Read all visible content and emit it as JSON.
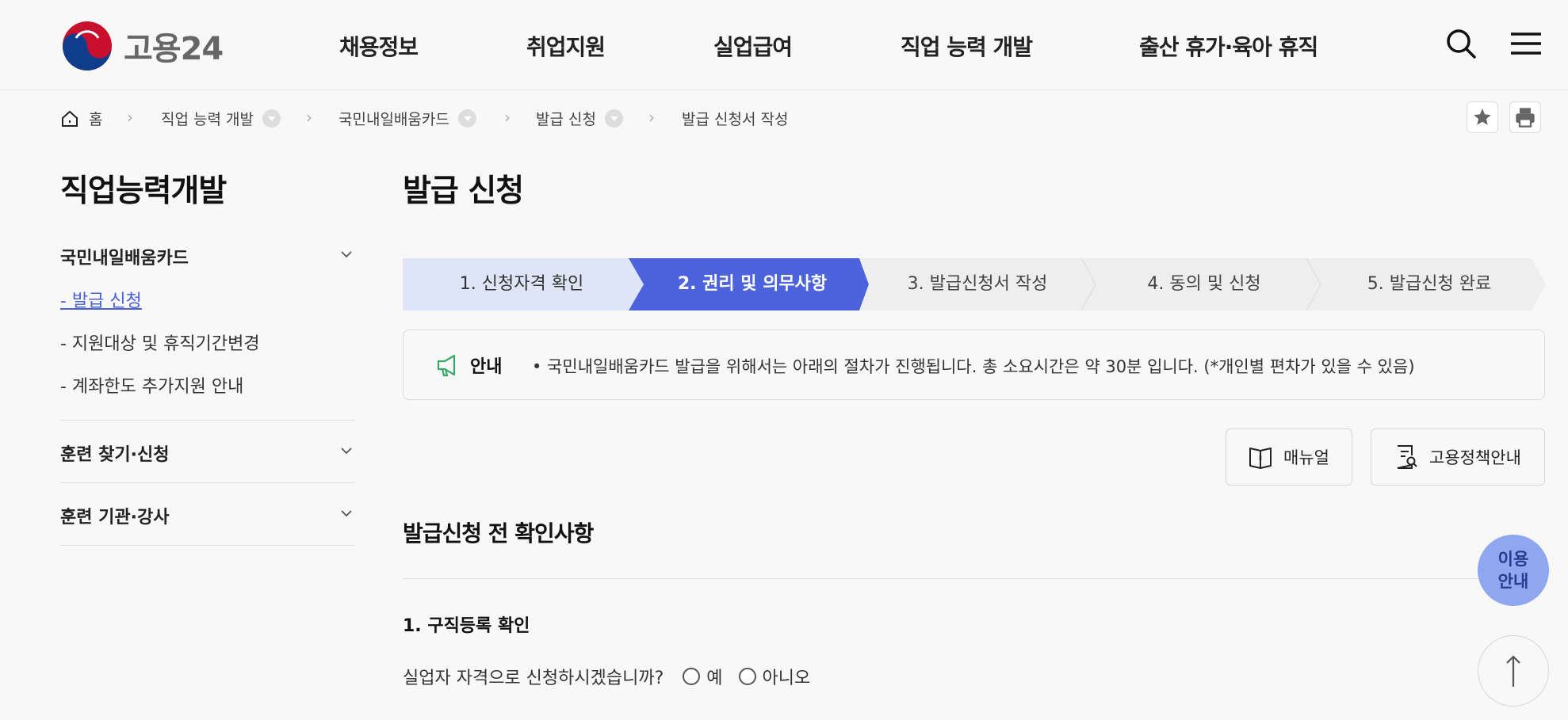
{
  "header": {
    "logo_text": "고용24",
    "nav": [
      "채용정보",
      "취업지원",
      "실업급여",
      "직업 능력 개발",
      "출산 휴가·육아 휴직"
    ]
  },
  "breadcrumb": {
    "home": "홈",
    "items": [
      "직업 능력 개발",
      "국민내일배움카드",
      "발급 신청",
      "발급 신청서 작성"
    ]
  },
  "lnb": {
    "title": "직업능력개발",
    "groups": [
      "국민내일배움카드",
      "훈련 찾기·신청",
      "훈련 기관·강사"
    ],
    "sub_items": [
      "- 발급 신청",
      "- 지원대상 및 휴직기간변경",
      "- 계좌한도 추가지원 안내"
    ],
    "active_index": 0
  },
  "content": {
    "page_title": "발급 신청",
    "steps": [
      "1. 신청자격 확인",
      "2. 권리 및 의무사항",
      "3. 발급신청서 작성",
      "4. 동의 및 신청",
      "5. 발급신청 완료"
    ],
    "current_step": 2,
    "notice_label": "안내",
    "notice_text": "• 국민내일배움카드 발급을 위해서는 아래의 절차가 진행됩니다. 총 소요시간은 약 30분 입니다. (*개인별 편차가 있을 수 있음)",
    "manual_button": "매뉴얼",
    "policy_button": "고용정책안내",
    "section_title": "발급신청 전 확인사항",
    "question_title": "1. 구직등록 확인",
    "question_text": "실업자 자격으로 신청하시겠습니까?",
    "option_yes": "예",
    "option_no": "아니오"
  },
  "floating": {
    "guide_line1": "이용",
    "guide_line2": "안내"
  },
  "colors": {
    "accent": "#4c63db",
    "step_done": "#dde5f6",
    "step_pending": "#eeeeee",
    "float_guide": "#8fa6f0"
  }
}
